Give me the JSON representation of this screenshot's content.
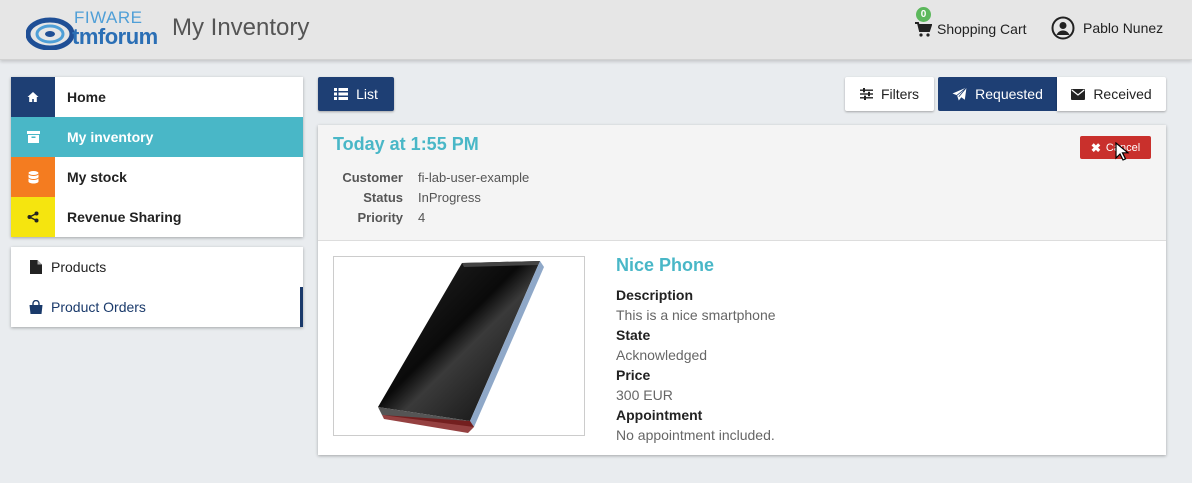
{
  "header": {
    "logo_line1": "FIWARE",
    "logo_line2": "tmforum",
    "title": "My Inventory",
    "cart_count": "0",
    "cart_label": "Shopping Cart",
    "user_name": "Pablo Nunez"
  },
  "sidebar": {
    "primary": [
      {
        "label": "Home",
        "icon": "home-icon",
        "color": "#1e3f74"
      },
      {
        "label": "My inventory",
        "icon": "archive-icon",
        "color": "#49b7c7"
      },
      {
        "label": "My stock",
        "icon": "database-icon",
        "color": "#f47c20"
      },
      {
        "label": "Revenue Sharing",
        "icon": "share-icon",
        "color": "#f5e50f"
      }
    ],
    "secondary": [
      {
        "label": "Products",
        "icon": "file-icon"
      },
      {
        "label": "Product Orders",
        "icon": "shopping-bag-icon"
      }
    ]
  },
  "toolbar": {
    "list_label": "List",
    "filters_label": "Filters",
    "requested_label": "Requested",
    "received_label": "Received"
  },
  "order": {
    "date": "Today at 1:55 PM",
    "customer_key": "Customer",
    "customer_val": "fi-lab-user-example",
    "status_key": "Status",
    "status_val": "InProgress",
    "priority_key": "Priority",
    "priority_val": "4",
    "cancel_label": "Cancel",
    "product": {
      "name": "Nice Phone",
      "description_key": "Description",
      "description_val": "This is a nice smartphone",
      "state_key": "State",
      "state_val": "Acknowledged",
      "price_key": "Price",
      "price_val": "300 EUR",
      "appointment_key": "Appointment",
      "appointment_val": "No appointment included."
    }
  },
  "colors": {
    "primary": "#1e3f74",
    "accent": "#49b7c7",
    "danger": "#c9302c",
    "badge": "#5cb85c"
  }
}
